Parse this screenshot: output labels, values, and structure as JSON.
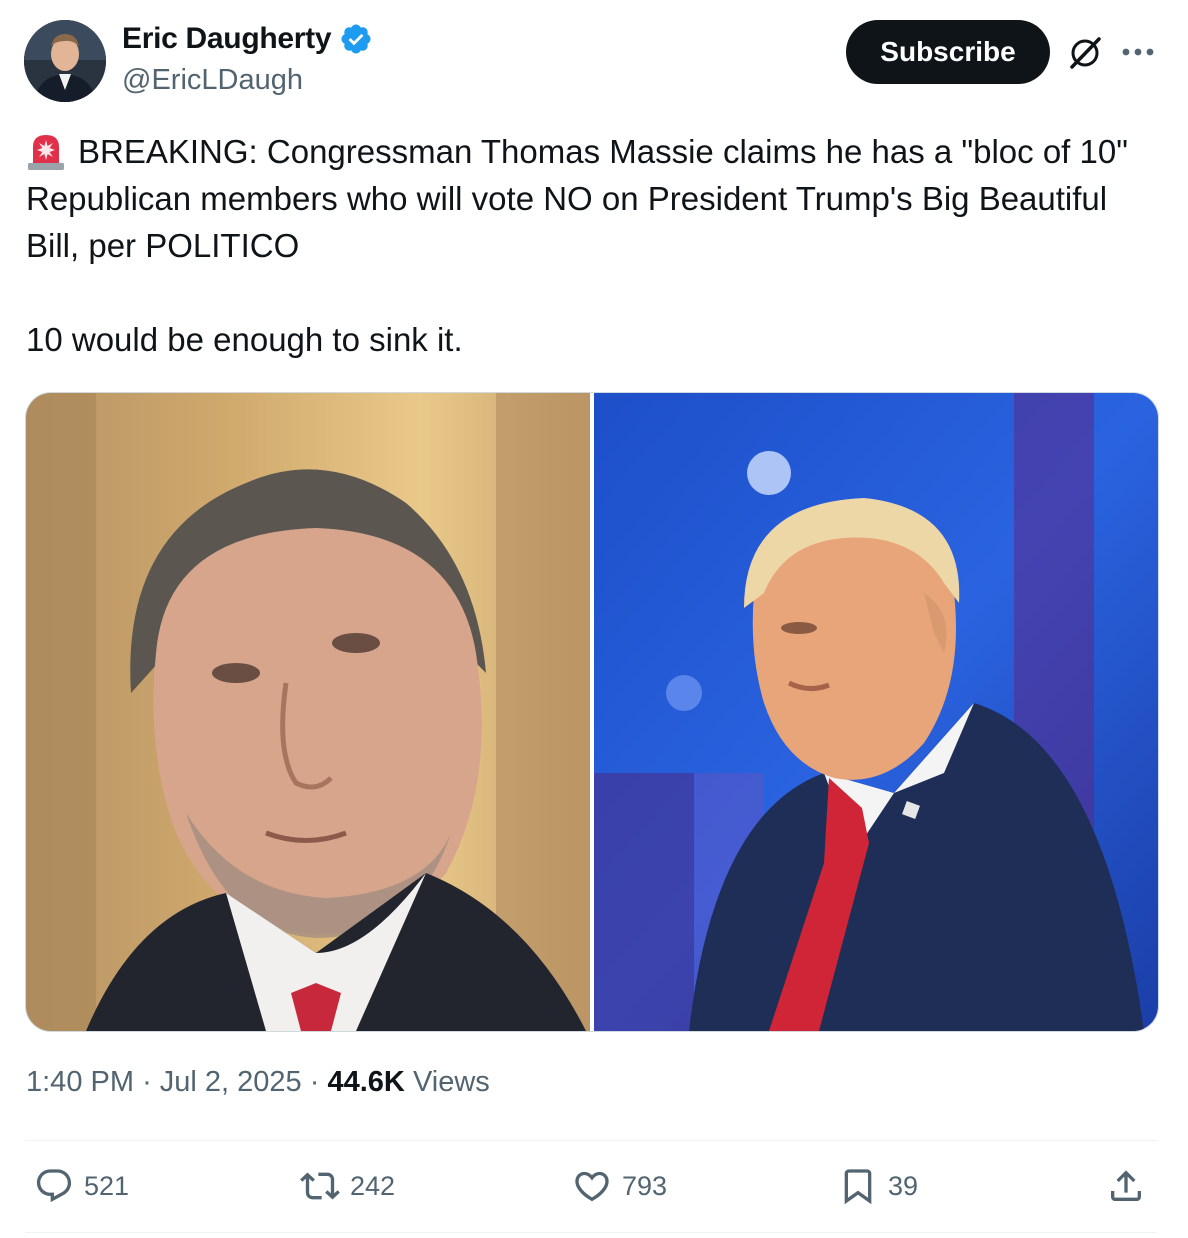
{
  "author": {
    "display_name": "Eric Daugherty",
    "handle": "@EricLDaugh",
    "verified": true
  },
  "header": {
    "subscribe_label": "Subscribe",
    "icons": [
      "grok-icon",
      "more-icon"
    ]
  },
  "tweet": {
    "line1": "BREAKING: Congressman Thomas Massie claims he has a \"bloc of 10\" Republican members who will vote NO on President Trump's Big Beautiful Bill, per POLITICO",
    "line2": "10 would be enough to sink it.",
    "leading_icon": "police-light-icon"
  },
  "media": {
    "count": 2,
    "photos": [
      "photo-thomas-massie",
      "photo-donald-trump"
    ]
  },
  "meta": {
    "time": "1:40 PM",
    "separator": "·",
    "date": "Jul 2, 2025",
    "views_count": "44.6K",
    "views_label": "Views"
  },
  "actions": {
    "replies": "521",
    "reposts": "242",
    "likes": "793",
    "bookmarks": "39"
  },
  "colors": {
    "text": "#0f1419",
    "secondary": "#536471",
    "verified_blue": "#1d9bf0",
    "button_bg": "#0f1419"
  }
}
